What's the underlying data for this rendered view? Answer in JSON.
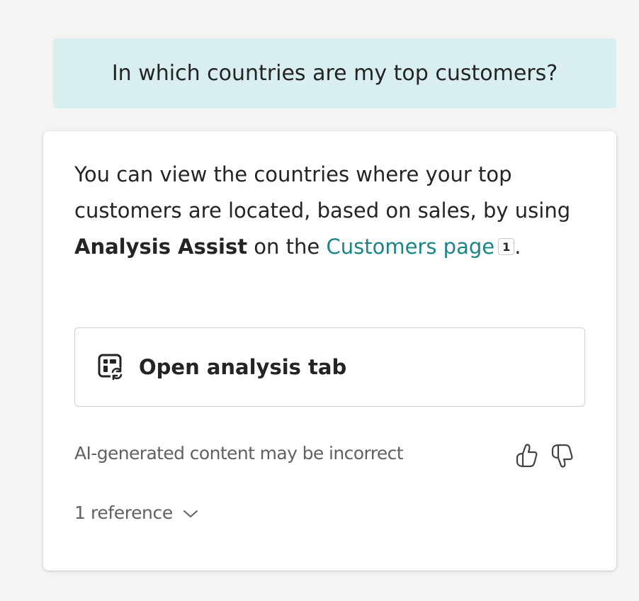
{
  "user_message": {
    "text": "In which countries are my top customers?"
  },
  "response": {
    "text_before_strong": "You can view the countries where your top customers are located, based on sales, by using ",
    "strong_text": "Analysis Assist",
    "text_after_strong": " on the ",
    "link_text": "Customers page",
    "citation_number": "1",
    "trailing_text": ".",
    "link_color": "#1b8586"
  },
  "action_button": {
    "label": "Open analysis tab",
    "icon": "analysis-tab-icon"
  },
  "footer": {
    "disclaimer": "AI-generated content may be incorrect",
    "thumbs_up_icon": "thumbs-up-icon",
    "thumbs_down_icon": "thumbs-down-icon"
  },
  "references": {
    "label": "1 reference",
    "icon": "chevron-down-icon"
  },
  "colors": {
    "background": "#f4f4f4",
    "user_bubble": "#d8eef0",
    "card": "#ffffff",
    "text_primary": "#242424",
    "text_secondary": "#616161"
  }
}
